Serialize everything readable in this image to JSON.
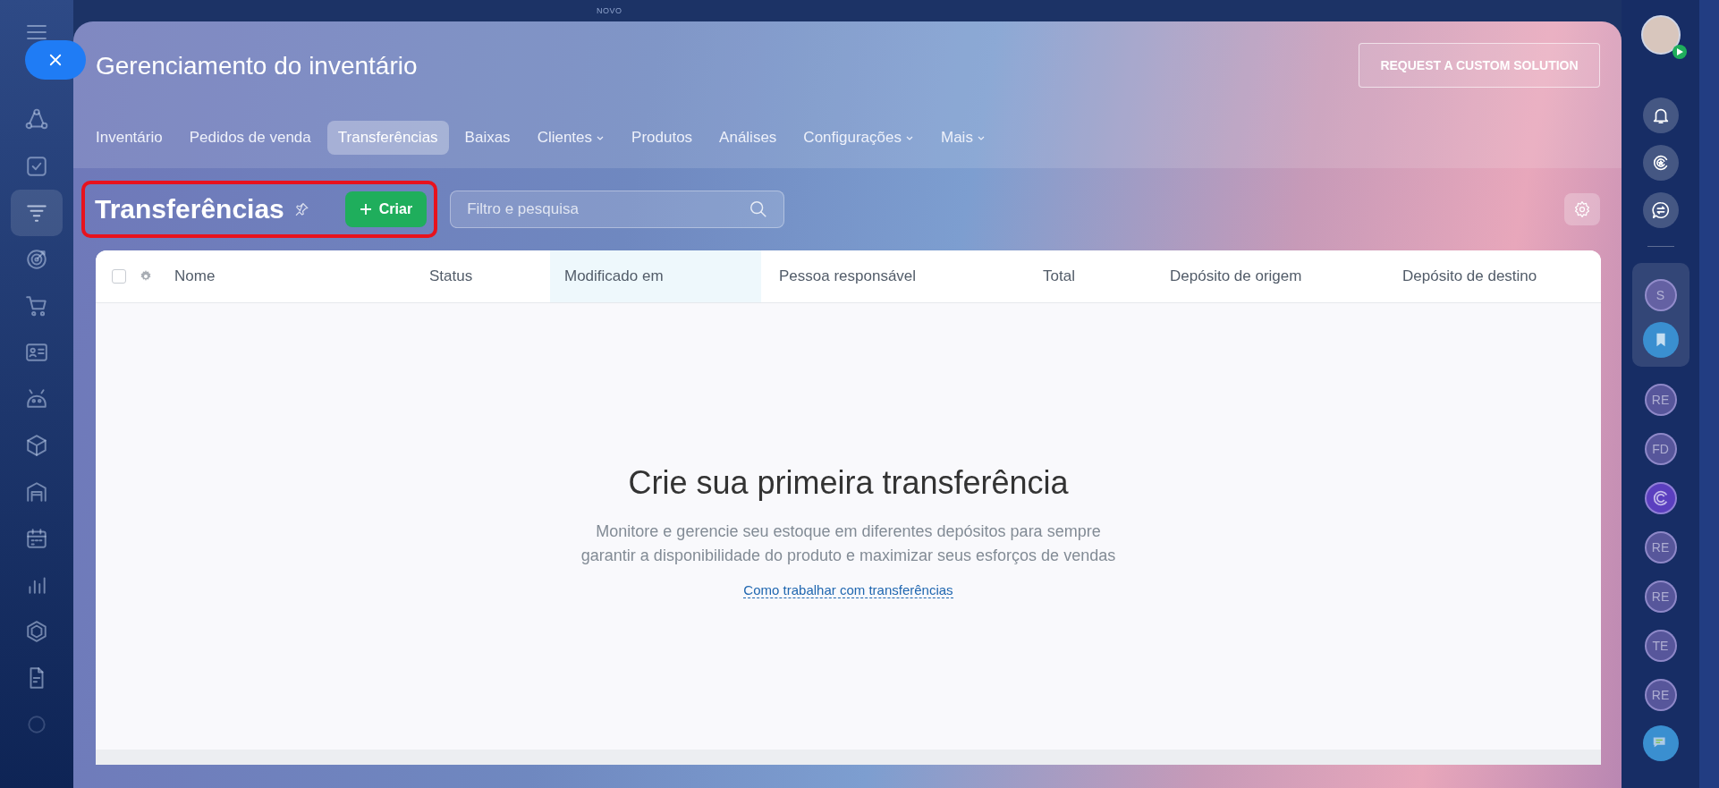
{
  "top_bar": {
    "badge": "NOVO"
  },
  "left_nav": {
    "items": [
      {
        "kind": "nodes",
        "selected": false
      },
      {
        "kind": "task",
        "selected": false
      },
      {
        "kind": "funnel",
        "selected": true
      },
      {
        "kind": "target",
        "selected": false
      },
      {
        "kind": "cart",
        "selected": false
      },
      {
        "kind": "card",
        "selected": false
      },
      {
        "kind": "robot",
        "selected": false
      },
      {
        "kind": "box",
        "selected": false
      },
      {
        "kind": "warehouse",
        "selected": false
      },
      {
        "kind": "calendar",
        "selected": false
      },
      {
        "kind": "chart",
        "selected": false
      },
      {
        "kind": "hexagon",
        "selected": false
      },
      {
        "kind": "document",
        "selected": false
      },
      {
        "kind": "faint",
        "selected": false
      }
    ]
  },
  "header": {
    "title": "Gerenciamento do inventário",
    "action_button": "REQUEST A CUSTOM SOLUTION"
  },
  "tabs": [
    {
      "label": "Inventário",
      "selected": false,
      "has_menu": false
    },
    {
      "label": "Pedidos de venda",
      "selected": false,
      "has_menu": false
    },
    {
      "label": "Transferências",
      "selected": true,
      "has_menu": false
    },
    {
      "label": "Baixas",
      "selected": false,
      "has_menu": false
    },
    {
      "label": "Clientes",
      "selected": false,
      "has_menu": true
    },
    {
      "label": "Produtos",
      "selected": false,
      "has_menu": false
    },
    {
      "label": "Análises",
      "selected": false,
      "has_menu": false
    },
    {
      "label": "Configurações",
      "selected": false,
      "has_menu": true
    },
    {
      "label": "Mais",
      "selected": false,
      "has_menu": true
    }
  ],
  "toolbar": {
    "title": "Transferências",
    "create_button": "Criar",
    "search": {
      "placeholder": "Filtro e pesquisa"
    }
  },
  "table": {
    "select_all": {
      "checked": false
    },
    "columns": [
      {
        "label": "Nome",
        "sorted": false
      },
      {
        "label": "Status",
        "sorted": false
      },
      {
        "label": "Modificado em",
        "sorted": true
      },
      {
        "label": "Pessoa responsável",
        "sorted": false
      },
      {
        "label": "Total",
        "sorted": false
      },
      {
        "label": "Depósito de origem",
        "sorted": false
      },
      {
        "label": "Depósito de destino",
        "sorted": false
      }
    ]
  },
  "empty_state": {
    "heading": "Crie sua primeira transferência",
    "description": "Monitore e gerencie seu estoque em diferentes depósitos para sempre garantir a disponibilidade do produto e maximizar seus esforços de vendas",
    "link": "Como trabalhar com transferências"
  },
  "right_bar": {
    "items": [
      {
        "kind": "avatar"
      },
      {
        "kind": "bell"
      },
      {
        "kind": "copilot"
      },
      {
        "kind": "chat-swap"
      },
      {
        "kind": "divider"
      }
    ],
    "pinned": [
      {
        "kind": "initials",
        "text": "S"
      },
      {
        "kind": "bookmark"
      }
    ],
    "chats": [
      {
        "kind": "initials",
        "text": "RE"
      },
      {
        "kind": "initials",
        "text": "FD"
      },
      {
        "kind": "copilot-round"
      },
      {
        "kind": "initials",
        "text": "RE"
      },
      {
        "kind": "initials",
        "text": "RE"
      },
      {
        "kind": "initials",
        "text": "TE"
      },
      {
        "kind": "initials",
        "text": "RE"
      },
      {
        "kind": "messages"
      }
    ]
  }
}
